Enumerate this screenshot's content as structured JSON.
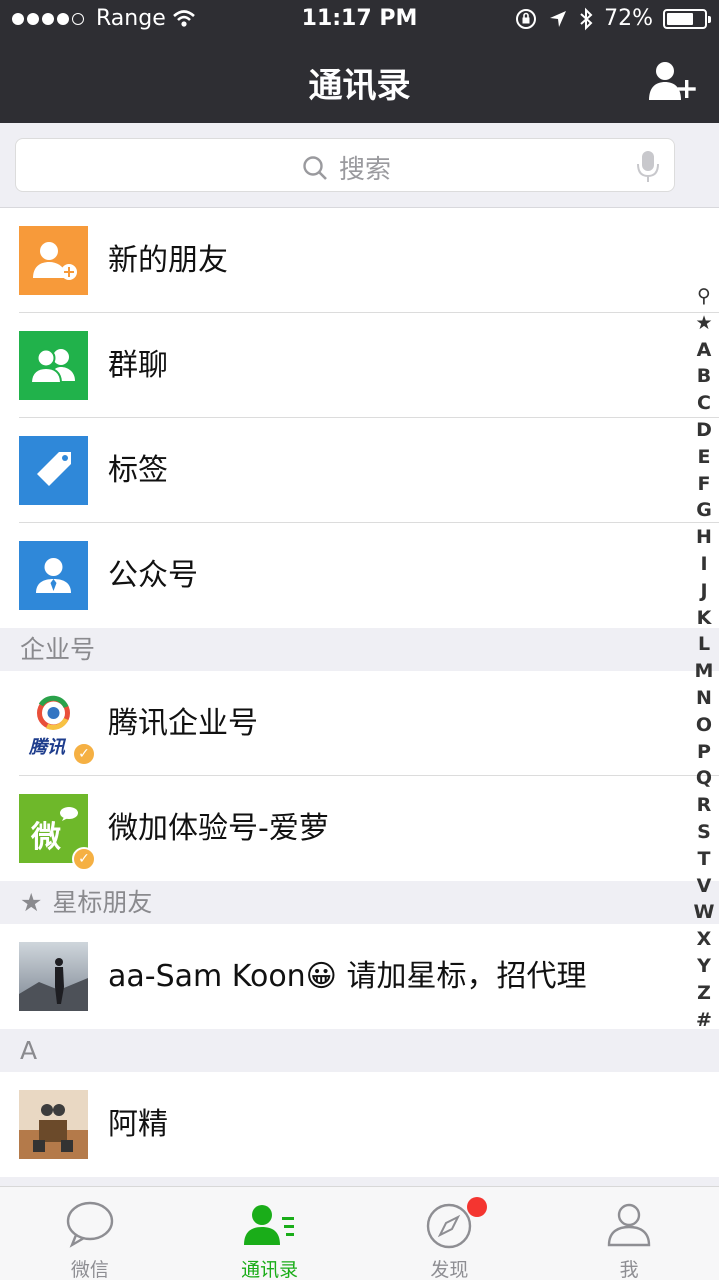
{
  "status_bar": {
    "carrier": "Range",
    "time": "11:17 PM",
    "battery_percent": "72%",
    "battery_level": 0.72
  },
  "nav": {
    "title": "通讯录",
    "add_icon": "add-contact-icon"
  },
  "search": {
    "placeholder": "搜索"
  },
  "list": {
    "new_friends": "新的朋友",
    "group_chat": "群聊",
    "tags": "标签",
    "official_accounts": "公众号",
    "section_enterprise": "企业号",
    "tencent_enterprise": "腾讯企业号",
    "tencent_logo_text": "腾讯",
    "weijia": "微加体验号-爱萝",
    "weijia_logo_text": "微",
    "section_starred": "星标朋友",
    "starred_contact": "aa-Sam Koon😀 请加星标，招代理",
    "section_a": "A",
    "contact_a": "阿精"
  },
  "index_letters": [
    "⚲",
    "★",
    "A",
    "B",
    "C",
    "D",
    "E",
    "F",
    "G",
    "H",
    "I",
    "J",
    "K",
    "L",
    "M",
    "N",
    "O",
    "P",
    "Q",
    "R",
    "S",
    "T",
    "V",
    "W",
    "X",
    "Y",
    "Z",
    "#"
  ],
  "tabbar": {
    "chats": "微信",
    "contacts": "通讯录",
    "discover": "发现",
    "me": "我"
  },
  "colors": {
    "nav_bg": "#2e2e33",
    "accent_green": "#1aad19",
    "new_friends_orange": "#f79a3a",
    "group_green": "#21b24b",
    "tags_blue": "#2f88d9",
    "official_blue": "#2f88d9",
    "badge_red": "#f43530"
  }
}
